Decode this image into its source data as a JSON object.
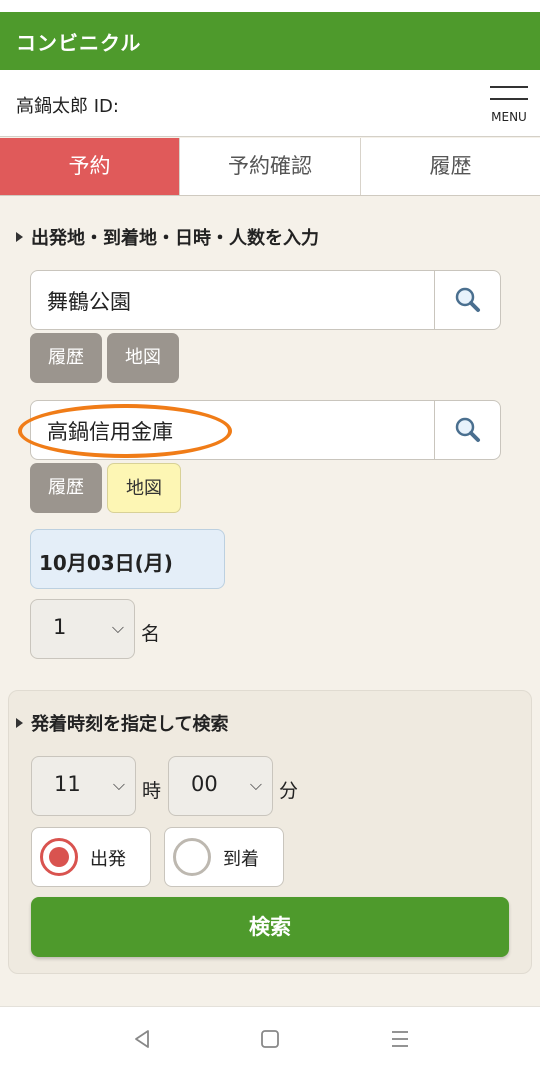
{
  "app": {
    "title": "コンビニクル"
  },
  "user": {
    "label": "高鍋太郎 ID:",
    "menu_label": "MENU"
  },
  "tabs": [
    {
      "label": "予約",
      "active": true
    },
    {
      "label": "予約確認",
      "active": false
    },
    {
      "label": "履歴",
      "active": false
    }
  ],
  "input_section": {
    "heading": "出発地・到着地・日時・人数を入力",
    "departure": {
      "value": "舞鶴公園",
      "history_label": "履歴",
      "map_label": "地図"
    },
    "arrival": {
      "value": "高鍋信用金庫",
      "history_label": "履歴",
      "map_label": "地図"
    },
    "date": "10月03日(月)",
    "people": {
      "value": "1",
      "unit": "名"
    }
  },
  "time_section": {
    "heading": "発着時刻を指定して検索",
    "hour": {
      "value": "11",
      "unit": "時"
    },
    "minute": {
      "value": "00",
      "unit": "分"
    },
    "departure_label": "出発",
    "arrival_label": "到着",
    "selected": "出発",
    "search_label": "検索"
  },
  "colors": {
    "brand_green": "#4e9a2c",
    "active_tab": "#e05a5a",
    "highlight_orange": "#f07c17",
    "map_highlight": "#fdf6b4",
    "date_bg": "#e4eef8"
  }
}
